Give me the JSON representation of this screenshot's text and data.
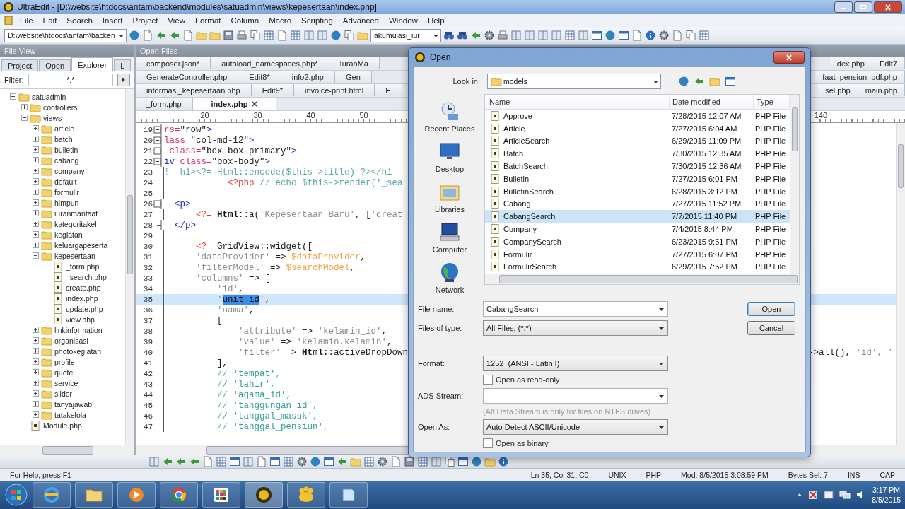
{
  "window": {
    "title": "UltraEdit - [D:\\website\\htdocs\\antam\\backend\\modules\\satuadmin\\views\\kepesertaan\\index.php]"
  },
  "menu": [
    "File",
    "Edit",
    "Search",
    "Insert",
    "Project",
    "View",
    "Format",
    "Column",
    "Macro",
    "Scripting",
    "Advanced",
    "Window",
    "Help"
  ],
  "toolbar": {
    "path": "D:\\website\\htdocs\\antam\\backen",
    "function_list": "akumulasi_iur"
  },
  "file_view": {
    "title": "File View",
    "tabs": [
      {
        "label": "Project",
        "selected": false
      },
      {
        "label": "Open",
        "selected": false
      },
      {
        "label": "Explorer",
        "selected": true
      },
      {
        "label": "L",
        "selected": false
      }
    ],
    "filter_label": "Filter:",
    "filter": "*.*",
    "tree": [
      {
        "label": "satuadmin",
        "kind": "folder",
        "expanded": true,
        "children": [
          {
            "label": "controllers",
            "kind": "folder",
            "expanded": false
          },
          {
            "label": "views",
            "kind": "folder",
            "expanded": true,
            "children": [
              {
                "label": "article",
                "kind": "folder",
                "expanded": false
              },
              {
                "label": "batch",
                "kind": "folder",
                "expanded": false
              },
              {
                "label": "bulletin",
                "kind": "folder",
                "expanded": false
              },
              {
                "label": "cabang",
                "kind": "folder",
                "expanded": false
              },
              {
                "label": "company",
                "kind": "folder",
                "expanded": false
              },
              {
                "label": "default",
                "kind": "folder",
                "expanded": false
              },
              {
                "label": "formulir",
                "kind": "folder",
                "expanded": false
              },
              {
                "label": "himpun",
                "kind": "folder",
                "expanded": false
              },
              {
                "label": "iuranmanfaat",
                "kind": "folder",
                "expanded": false
              },
              {
                "label": "kategoritakel",
                "kind": "folder",
                "expanded": false
              },
              {
                "label": "kegiatan",
                "kind": "folder",
                "expanded": false
              },
              {
                "label": "keluargapeserta",
                "kind": "folder",
                "expanded": false
              },
              {
                "label": "kepesertaan",
                "kind": "folder",
                "expanded": true,
                "children": [
                  {
                    "label": "_form.php",
                    "kind": "file"
                  },
                  {
                    "label": "_search.php",
                    "kind": "file"
                  },
                  {
                    "label": "create.php",
                    "kind": "file"
                  },
                  {
                    "label": "index.php",
                    "kind": "file"
                  },
                  {
                    "label": "update.php",
                    "kind": "file"
                  },
                  {
                    "label": "view.php",
                    "kind": "file"
                  }
                ]
              },
              {
                "label": "linkinformation",
                "kind": "folder",
                "expanded": false
              },
              {
                "label": "organisasi",
                "kind": "folder",
                "expanded": false
              },
              {
                "label": "photokegiatan",
                "kind": "folder",
                "expanded": false
              },
              {
                "label": "profile",
                "kind": "folder",
                "expanded": false
              },
              {
                "label": "quote",
                "kind": "folder",
                "expanded": false
              },
              {
                "label": "service",
                "kind": "folder",
                "expanded": false
              },
              {
                "label": "slider",
                "kind": "folder",
                "expanded": false
              },
              {
                "label": "tanyajawab",
                "kind": "folder",
                "expanded": false
              },
              {
                "label": "tatakelola",
                "kind": "folder",
                "expanded": false
              }
            ]
          },
          {
            "label": "Module.php",
            "kind": "file"
          }
        ]
      }
    ]
  },
  "open_files": {
    "title": "Open Files",
    "tab_rows": [
      {
        "tabs": [
          {
            "label": "composer.json*",
            "selected": false
          },
          {
            "label": "autoload_namespaces.php*",
            "selected": false
          },
          {
            "label": "IuranMa",
            "selected": false
          }
        ],
        "tabs_right": [
          {
            "label": "dex.php",
            "selected": false
          },
          {
            "label": "Edit7",
            "selected": false
          }
        ]
      },
      {
        "tabs": [
          {
            "label": "GenerateController.php",
            "selected": false
          },
          {
            "label": "Edit8*",
            "selected": false
          },
          {
            "label": "info2.php",
            "selected": false
          },
          {
            "label": "Gen",
            "selected": false
          }
        ],
        "tabs_right": [
          {
            "label": "faat_pensiun_pdf.php",
            "selected": false
          }
        ]
      },
      {
        "tabs": [
          {
            "label": "informasi_kepesertaan.php",
            "selected": false
          },
          {
            "label": "Edit9*",
            "selected": false
          },
          {
            "label": "invoice-print.html",
            "selected": false
          },
          {
            "label": "E",
            "selected": false
          }
        ],
        "tabs_right": [
          {
            "label": "sel.php",
            "selected": false
          },
          {
            "label": "main.php",
            "selected": false
          }
        ]
      },
      {
        "tabs": [
          {
            "label": "_form.php",
            "selected": false
          },
          {
            "label": "index.php",
            "selected": true
          }
        ]
      }
    ]
  },
  "editor": {
    "ruler": [
      "20",
      "30",
      "40",
      "50",
      "140"
    ],
    "lines": [
      {
        "number": "19",
        "kind": "start",
        "tokens": [
          {
            "kind": "attr",
            "text": "rs="
          },
          {
            "kind": "str",
            "text": "\"row\""
          },
          {
            "kind": "tag",
            "text": ">"
          }
        ]
      },
      {
        "number": "20",
        "kind": "start",
        "tokens": [
          {
            "kind": "attr",
            "text": "lass="
          },
          {
            "kind": "str",
            "text": "\"col-md-12\""
          },
          {
            "kind": "tag",
            "text": ">"
          }
        ]
      },
      {
        "number": "21",
        "kind": "start",
        "tokens": [
          {
            "kind": "attr",
            "text": " class="
          },
          {
            "kind": "str",
            "text": "\"box box-primary\""
          },
          {
            "kind": "tag",
            "text": ">"
          }
        ]
      },
      {
        "number": "22",
        "kind": "start",
        "tokens": [
          {
            "kind": "tag",
            "text": "iv "
          },
          {
            "kind": "attr",
            "text": "class="
          },
          {
            "kind": "str",
            "text": "\"box-body\""
          },
          {
            "kind": "tag",
            "text": ">"
          }
        ]
      },
      {
        "number": "23",
        "kind": "line",
        "tokens": [
          {
            "kind": "comment",
            "text": "!--h1><?= Html::encode($this->title) ?></h1--"
          }
        ]
      },
      {
        "number": "24",
        "kind": "line",
        "tokens": [
          {
            "kind": "php",
            "text": "            <?php"
          },
          {
            "kind": "comment",
            "text": " // echo $this->render('_sea"
          }
        ]
      },
      {
        "number": "25",
        "kind": "line"
      },
      {
        "number": "26",
        "kind": "start",
        "tokens": [
          {
            "kind": "tag",
            "text": "  <p>"
          }
        ]
      },
      {
        "number": "27",
        "kind": "line",
        "tokens": [
          {
            "kind": "php",
            "text": "      <?="
          },
          {
            "kind": "cls",
            "text": " Html"
          },
          {
            "kind": "plain",
            "text": "::a("
          },
          {
            "kind": "key",
            "text": "'Kepesertaan Baru'"
          },
          {
            "kind": "plain",
            "text": ", ["
          },
          {
            "kind": "key",
            "text": "'creat"
          }
        ]
      },
      {
        "number": "28",
        "kind": "end",
        "tokens": [
          {
            "kind": "tag",
            "text": "  </p>"
          }
        ]
      },
      {
        "number": "29",
        "kind": "line"
      },
      {
        "number": "30",
        "kind": "line",
        "tokens": [
          {
            "kind": "php",
            "text": "      <?="
          },
          {
            "kind": "plain",
            "text": " GridView::widget(["
          }
        ]
      },
      {
        "number": "31",
        "kind": "line",
        "tokens": [
          {
            "kind": "key",
            "text": "      'dataProvider'"
          },
          {
            "kind": "plain",
            "text": " => "
          },
          {
            "kind": "var",
            "text": "$dataProvider"
          },
          {
            "kind": "plain",
            "text": ","
          }
        ]
      },
      {
        "number": "32",
        "kind": "line",
        "tokens": [
          {
            "kind": "key",
            "text": "      'filterModel'"
          },
          {
            "kind": "plain",
            "text": " => "
          },
          {
            "kind": "var",
            "text": "$searchModel"
          },
          {
            "kind": "plain",
            "text": ","
          }
        ]
      },
      {
        "number": "33",
        "kind": "line",
        "tokens": [
          {
            "kind": "key",
            "text": "      'columns'"
          },
          {
            "kind": "plain",
            "text": " => ["
          }
        ]
      },
      {
        "number": "34",
        "kind": "line",
        "tokens": [
          {
            "kind": "key",
            "text": "          'id'"
          },
          {
            "kind": "plain",
            "text": ","
          }
        ]
      },
      {
        "number": "35",
        "kind": "line",
        "current": true,
        "tokens": [
          {
            "kind": "key",
            "text": "          '"
          },
          {
            "kind": "selection",
            "text": "unit_id"
          },
          {
            "kind": "key",
            "text": "'"
          },
          {
            "kind": "plain",
            "text": ","
          }
        ]
      },
      {
        "number": "36",
        "kind": "line",
        "tokens": [
          {
            "kind": "key",
            "text": "          'nama'"
          },
          {
            "kind": "plain",
            "text": ","
          }
        ]
      },
      {
        "number": "37",
        "kind": "line",
        "tokens": [
          {
            "kind": "plain",
            "text": "          ["
          }
        ]
      },
      {
        "number": "38",
        "kind": "line",
        "tokens": [
          {
            "kind": "key",
            "text": "              'attribute'"
          },
          {
            "kind": "plain",
            "text": " => "
          },
          {
            "kind": "key",
            "text": "'kelamin_id'"
          },
          {
            "kind": "plain",
            "text": ","
          }
        ]
      },
      {
        "number": "39",
        "kind": "line",
        "tokens": [
          {
            "kind": "key",
            "text": "              'value'"
          },
          {
            "kind": "plain",
            "text": " => "
          },
          {
            "kind": "key",
            "text": "'kelamin.kelamin'"
          },
          {
            "kind": "plain",
            "text": ","
          }
        ]
      },
      {
        "number": "40",
        "kind": "line",
        "tokens": [
          {
            "kind": "key",
            "text": "              'filter'"
          },
          {
            "kind": "plain",
            "text": " => "
          },
          {
            "kind": "cls",
            "text": "Html"
          },
          {
            "kind": "plain",
            "text": "::activeDropDown"
          }
        ],
        "tail": [
          {
            "kind": "plain",
            "text": "->all(), "
          },
          {
            "kind": "key",
            "text": "'id', '"
          }
        ]
      },
      {
        "number": "41",
        "kind": "line",
        "tokens": [
          {
            "kind": "plain",
            "text": "          ],"
          }
        ]
      },
      {
        "number": "42",
        "kind": "line",
        "tokens": [
          {
            "kind": "comment",
            "text": "          // "
          },
          {
            "kind": "cstr",
            "text": "'tempat'"
          },
          {
            "kind": "comment",
            "text": ","
          }
        ]
      },
      {
        "number": "43",
        "kind": "line",
        "tokens": [
          {
            "kind": "comment",
            "text": "          // "
          },
          {
            "kind": "cstr",
            "text": "'lahir'"
          },
          {
            "kind": "comment",
            "text": ","
          }
        ]
      },
      {
        "number": "44",
        "kind": "line",
        "tokens": [
          {
            "kind": "comment",
            "text": "          // "
          },
          {
            "kind": "cstr",
            "text": "'agama_id'"
          },
          {
            "kind": "comment",
            "text": ","
          }
        ]
      },
      {
        "number": "45",
        "kind": "line",
        "tokens": [
          {
            "kind": "comment",
            "text": "          // "
          },
          {
            "kind": "cstr",
            "text": "'tanggungan_id'"
          },
          {
            "kind": "comment",
            "text": ","
          }
        ]
      },
      {
        "number": "46",
        "kind": "line",
        "tokens": [
          {
            "kind": "comment",
            "text": "          // "
          },
          {
            "kind": "cstr",
            "text": "'tanggal_masuk'"
          },
          {
            "kind": "comment",
            "text": ","
          }
        ]
      },
      {
        "number": "47",
        "kind": "line",
        "tokens": [
          {
            "kind": "comment",
            "text": "          // "
          },
          {
            "kind": "cstr",
            "text": "'tanggal_pensiun'"
          },
          {
            "kind": "comment",
            "text": ","
          }
        ]
      }
    ]
  },
  "dialog": {
    "title": "Open",
    "look_in_label": "Look in:",
    "look_in": "models",
    "places": [
      {
        "label": "Recent Places",
        "kind": "recent"
      },
      {
        "label": "Desktop",
        "kind": "desktop"
      },
      {
        "label": "Libraries",
        "kind": "libraries"
      },
      {
        "label": "Computer",
        "kind": "computer"
      },
      {
        "label": "Network",
        "kind": "network"
      }
    ],
    "columns": [
      "Name",
      "Date modified",
      "Type"
    ],
    "files": [
      {
        "name": "Approve",
        "date": "7/28/2015 12:07 AM",
        "type": "PHP File",
        "selected": false
      },
      {
        "name": "Article",
        "date": "7/27/2015 6:04 AM",
        "type": "PHP File",
        "selected": false
      },
      {
        "name": "ArticleSearch",
        "date": "6/29/2015 11:09 PM",
        "type": "PHP File",
        "selected": false
      },
      {
        "name": "Batch",
        "date": "7/30/2015 12:35 AM",
        "type": "PHP File",
        "selected": false
      },
      {
        "name": "BatchSearch",
        "date": "7/30/2015 12:36 AM",
        "type": "PHP File",
        "selected": false
      },
      {
        "name": "Bulletin",
        "date": "7/27/2015 6:01 PM",
        "type": "PHP File",
        "selected": false
      },
      {
        "name": "BulletinSearch",
        "date": "6/28/2015 3:12 PM",
        "type": "PHP File",
        "selected": false
      },
      {
        "name": "Cabang",
        "date": "7/27/2015 11:52 PM",
        "type": "PHP File",
        "selected": false
      },
      {
        "name": "CabangSearch",
        "date": "7/7/2015 11:40 PM",
        "type": "PHP File",
        "selected": true
      },
      {
        "name": "Company",
        "date": "7/4/2015 8:44 PM",
        "type": "PHP File",
        "selected": false
      },
      {
        "name": "CompanySearch",
        "date": "6/23/2015 9:51 PM",
        "type": "PHP File",
        "selected": false
      },
      {
        "name": "Formulir",
        "date": "7/27/2015 6:07 PM",
        "type": "PHP File",
        "selected": false
      },
      {
        "name": "FormulirSearch",
        "date": "6/29/2015 7:52 PM",
        "type": "PHP File",
        "selected": false
      }
    ],
    "file_name_label": "File name:",
    "file_name": "CabangSearch",
    "file_type_label": "Files of type:",
    "file_type": "All Files, (*.*)",
    "format_label": "Format:",
    "format": "1252  (ANSI - Latin I)",
    "read_only": {
      "label": "Open as read-only",
      "checked": false
    },
    "ads_label": "ADS Stream:",
    "ads_note": "(Alt Data Stream is only for files on NTFS drives)",
    "open_as_label": "Open As:",
    "open_as": "Auto Detect ASCII/Unicode",
    "binary": {
      "label": "Open as binary",
      "checked": false
    },
    "buttons": [
      "Open",
      "Cancel"
    ]
  },
  "status_bar": {
    "help": "For Help, press F1",
    "position": "Ln 35, Col 31, C0",
    "line_ending": "UNIX",
    "syntax": "PHP",
    "modified": "Mod: 8/5/2015 3:08:59 PM",
    "bytes_selected": "Bytes Sel: 7",
    "mode": "INS",
    "caps": "CAP"
  },
  "taskbar": {
    "time": "3:17 PM",
    "date": "8/5/2015"
  }
}
